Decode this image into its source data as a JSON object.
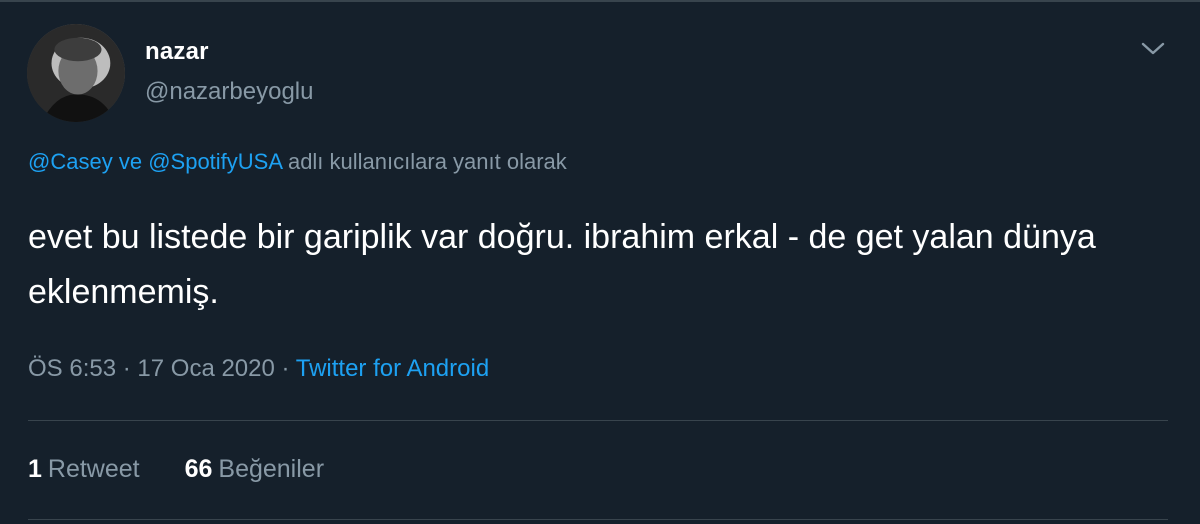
{
  "author": {
    "display_name": "nazar",
    "handle": "@nazarbeyoglu"
  },
  "reply": {
    "mention_1": "@Casey",
    "connector": "ve",
    "mention_2": "@SpotifyUSA",
    "suffix": "adlı kullanıcılara yanıt olarak"
  },
  "tweet": {
    "text": "evet bu listede bir gariplik var doğru. ibrahim erkal - de get yalan dünya eklenmemiş."
  },
  "meta": {
    "time": "ÖS 6:53",
    "date": "17 Oca 2020",
    "separator": "·",
    "source": "Twitter for Android"
  },
  "stats": {
    "retweets_count": "1",
    "retweets_label": "Retweet",
    "likes_count": "66",
    "likes_label": "Beğeniler"
  },
  "colors": {
    "background": "#15202b",
    "secondary_text": "#8899a6",
    "link": "#1da1f2",
    "divider": "#38444d"
  },
  "icons": {
    "menu": "chevron-down-icon"
  }
}
